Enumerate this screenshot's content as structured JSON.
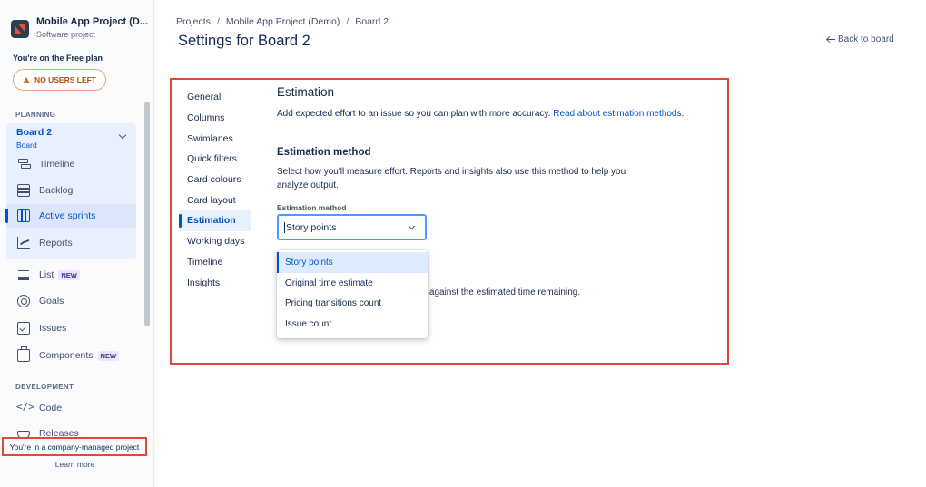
{
  "sidebar": {
    "project_name": "Mobile App Project (D...",
    "project_type": "Software project",
    "plan_text": "You're on the Free plan",
    "no_users_label": "NO USERS LEFT",
    "planning_title": "PLANNING",
    "board_title": "Board 2",
    "board_sub": "Board",
    "nav": [
      {
        "label": "Timeline",
        "icon": "timeline-icon"
      },
      {
        "label": "Backlog",
        "icon": "backlog-icon"
      },
      {
        "label": "Active sprints",
        "icon": "sprints-icon",
        "active": true
      },
      {
        "label": "Reports",
        "icon": "reports-icon"
      }
    ],
    "list_label": "List",
    "list_badge": "NEW",
    "goals_label": "Goals",
    "issues_label": "Issues",
    "components_label": "Components",
    "components_badge": "NEW",
    "development_title": "DEVELOPMENT",
    "code_label": "Code",
    "releases_label": "Releases",
    "company_managed": "You're in a company-managed project",
    "learn_more": "Learn more"
  },
  "breadcrumb": [
    "Projects",
    "Mobile App Project (Demo)",
    "Board 2"
  ],
  "page_title": "Settings for Board 2",
  "back_label": "Back to board",
  "settings_nav": [
    "General",
    "Columns",
    "Swimlanes",
    "Quick filters",
    "Card colours",
    "Card layout",
    "Estimation",
    "Working days",
    "Timeline",
    "Insights"
  ],
  "settings_nav_active": "Estimation",
  "estimation": {
    "heading": "Estimation",
    "desc": "Add expected effort to an issue so you can plan with more accuracy.",
    "link": "Read about estimation methods",
    "link_suffix": ".",
    "method_heading": "Estimation method",
    "method_desc": "Select how you'll measure effort. Reports and insights also use this method to help you analyze output.",
    "field_label": "Estimation method",
    "selected_value": "Story points",
    "partial_text": "sue against the estimated time remaining.",
    "options": [
      "Story points",
      "Original time estimate",
      "Pricing transitions count",
      "Issue count"
    ]
  },
  "colors": {
    "accent": "#0052cc",
    "highlight_border": "#de4a36",
    "warning": "#bf4a10"
  }
}
